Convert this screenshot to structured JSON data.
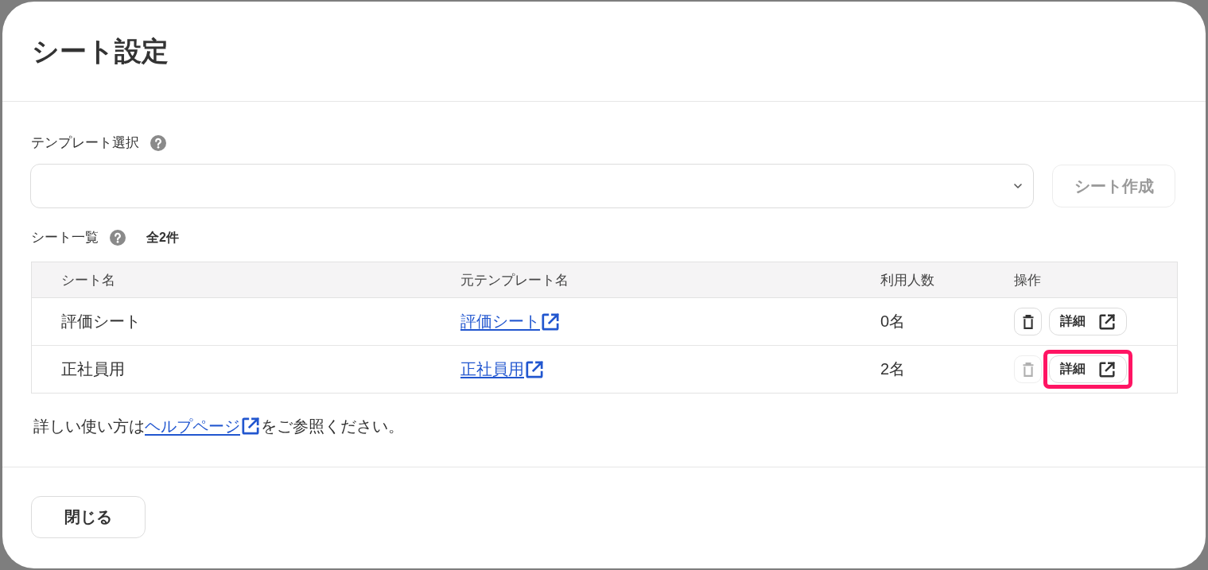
{
  "dialog": {
    "title": "シート設定"
  },
  "template_select": {
    "label": "テンプレート選択"
  },
  "create_button": {
    "label": "シート作成",
    "disabled": true
  },
  "sheet_list": {
    "label": "シート一覧",
    "count": "全2件",
    "columns": [
      "シート名",
      "元テンプレート名",
      "利用人数",
      "操作"
    ],
    "rows": [
      {
        "sheet_name": "評価シート",
        "template": "評価シート",
        "users": "0名",
        "delete": {
          "disabled": false
        },
        "detail": "詳細",
        "highlighted": false
      },
      {
        "sheet_name": "正社員用",
        "template": "正社員用",
        "users": "2名",
        "delete": {
          "disabled": true
        },
        "detail": "詳細",
        "highlighted": true
      }
    ]
  },
  "help": {
    "text_before": "詳しい使い方は",
    "link": "ヘルプページ",
    "text_after": "をご参照ください。"
  },
  "close_button": {
    "label": "閉じる"
  }
}
